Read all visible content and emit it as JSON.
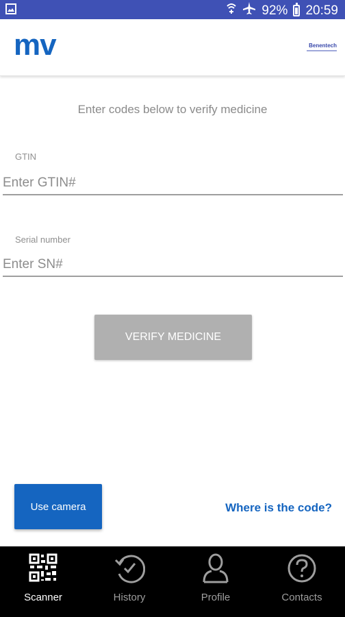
{
  "status_bar": {
    "battery": "92%",
    "time": "20:59"
  },
  "header": {
    "logo": "mv",
    "partner_logo": "Benentech"
  },
  "instruction": "Enter codes below to verify medicine",
  "gtin": {
    "label": "GTIN",
    "placeholder": "Enter GTIN#"
  },
  "serial": {
    "label": "Serial number",
    "placeholder": "Enter SN#"
  },
  "verify_label": "VERIFY MEDICINE",
  "camera_label": "Use camera",
  "where_label": "Where is the code?",
  "nav": {
    "items": [
      {
        "label": "Scanner",
        "icon": "qr-code-icon",
        "active": true
      },
      {
        "label": "History",
        "icon": "history-icon"
      },
      {
        "label": "Profile",
        "icon": "profile-icon"
      },
      {
        "label": "Contacts",
        "icon": "help-icon"
      }
    ]
  },
  "colors": {
    "status_bar": "#3f51b5",
    "brand": "#1565c0",
    "button_disabled": "#b0b0b0",
    "nav_background": "#000000"
  }
}
